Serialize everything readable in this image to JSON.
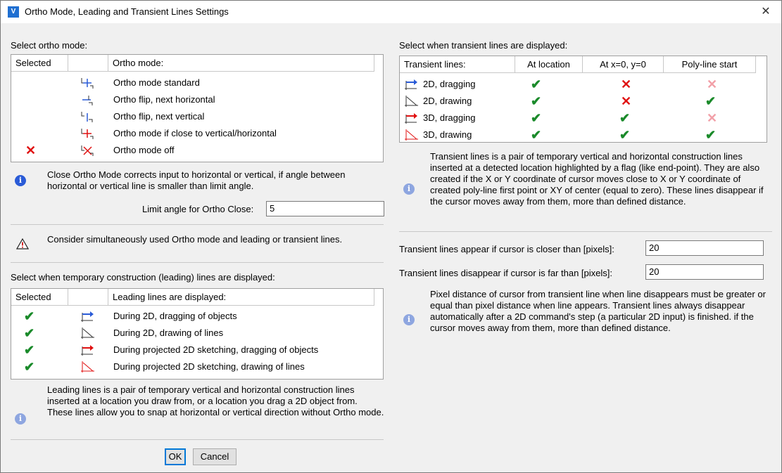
{
  "window": {
    "title": "Ortho Mode, Leading and Transient Lines Settings",
    "close_glyph": "✕",
    "app_icon": "V"
  },
  "ortho": {
    "section_label": "Select ortho mode:",
    "headers": [
      "Selected",
      "",
      "Ortho mode:"
    ],
    "rows": [
      {
        "selected": "",
        "icon": "ortho-standard-icon",
        "label": "Ortho mode standard"
      },
      {
        "selected": "",
        "icon": "ortho-flip-horizontal-icon",
        "label": "Ortho flip, next horizontal"
      },
      {
        "selected": "",
        "icon": "ortho-flip-vertical-icon",
        "label": "Ortho flip, next vertical"
      },
      {
        "selected": "",
        "icon": "ortho-close-icon",
        "label": "Ortho mode if close to vertical/horizontal"
      },
      {
        "selected": "✕",
        "icon": "ortho-off-icon",
        "label": "Ortho mode off"
      }
    ],
    "info": "Close Ortho Mode corrects input to horizontal or vertical,  if angle between horizontal or vertical line is smaller than limit angle.",
    "limit_label": "Limit angle for Ortho Close:",
    "limit_value": "5",
    "warning": "Consider simultaneously used Ortho mode and leading or transient lines."
  },
  "leading": {
    "section_label": "Select when temporary construction (leading) lines are displayed:",
    "headers": [
      "Selected",
      "",
      "Leading lines are displayed:"
    ],
    "rows": [
      {
        "selected": "✔",
        "icon": "leading-2d-drag-icon",
        "label": "During 2D, dragging of objects"
      },
      {
        "selected": "✔",
        "icon": "leading-2d-draw-icon",
        "label": "During 2D, drawing of lines"
      },
      {
        "selected": "✔",
        "icon": "leading-proj-drag-icon",
        "label": "During projected 2D sketching, dragging of objects"
      },
      {
        "selected": "✔",
        "icon": "leading-proj-draw-icon",
        "label": "During projected 2D sketching, drawing of lines"
      }
    ],
    "info": "Leading lines is a pair of temporary vertical and horizontal construction lines inserted at a location you draw from, or a location you drag a 2D object from. These lines allow you to snap at horizontal or vertical direction without Ortho mode."
  },
  "transient": {
    "section_label": "Select when transient lines are displayed:",
    "headers": [
      "Transient lines:",
      "At location",
      "At x=0, y=0",
      "Poly-line start"
    ],
    "rows": [
      {
        "label": "2D, dragging",
        "at_location": "check",
        "at_zero": "cross",
        "poly_start": "cross-light"
      },
      {
        "label": "2D, drawing",
        "at_location": "check",
        "at_zero": "cross",
        "poly_start": "check"
      },
      {
        "label": "3D, dragging",
        "at_location": "check",
        "at_zero": "check",
        "poly_start": "cross-light"
      },
      {
        "label": "3D, drawing",
        "at_location": "check",
        "at_zero": "check",
        "poly_start": "check"
      }
    ],
    "info": "Transient lines is a pair of temporary vertical and horizontal construction lines inserted at a detected location highlighted by a flag (like end-point). They are also created if the X or Y coordinate of cursor moves close to X or Y coordinate of created poly-line first point or XY of center (equal to zero). These lines disappear if the cursor moves away from them, more than defined distance.",
    "appear_label": "Transient lines appear if cursor is closer than [pixels]:",
    "appear_value": "20",
    "disappear_label": "Transient lines disappear if cursor is far than [pixels]:",
    "disappear_value": "20",
    "pixel_info": "Pixel distance of cursor from transient line when line disappears must be greater or equal than pixel distance when line appears. Transient lines always disappear automatically after a 2D command's step (a particular 2D input) is finished. if the cursor moves away from them, more than defined distance."
  },
  "buttons": {
    "ok": "OK",
    "cancel": "Cancel"
  },
  "glyphs": {
    "check": "✔",
    "cross": "✕",
    "info": "i",
    "warning": "!"
  },
  "colors": {
    "check": "#1a8a2a",
    "cross": "#e01010",
    "cross_light": "#f2a0a8",
    "accent": "#0078d7"
  }
}
